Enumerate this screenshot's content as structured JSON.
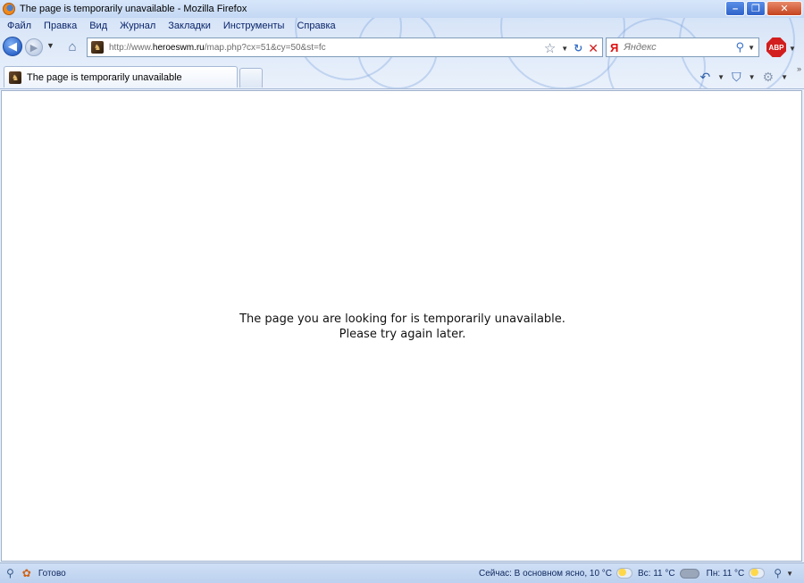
{
  "window": {
    "title": "The page is temporarily unavailable - Mozilla Firefox"
  },
  "menu": [
    "Файл",
    "Правка",
    "Вид",
    "Журнал",
    "Закладки",
    "Инструменты",
    "Справка"
  ],
  "address": {
    "url_prefix": "http://www.",
    "url_domain": "heroeswm.ru",
    "url_path": "/map.php?cx=51&cy=50&st=fc"
  },
  "search": {
    "engine_icon": "Я",
    "placeholder": "Яндекс"
  },
  "addon": {
    "abp_label": "ABP"
  },
  "tab": {
    "label": "The page is temporarily unavailable"
  },
  "content": {
    "line1": "The page you are looking for is temporarily unavailable.",
    "line2": "Please try again later."
  },
  "status": {
    "text": "Готово",
    "weather_now": "Сейчас: В основном ясно, 10 °C",
    "weather_sun": "Вс: 11 °C",
    "weather_mon": "Пн: 11 °C"
  },
  "colors": {
    "chrome": "#dbe7f8",
    "link_text": "#0a246a",
    "stop_red": "#d02020",
    "abp_red": "#d21e1e"
  }
}
